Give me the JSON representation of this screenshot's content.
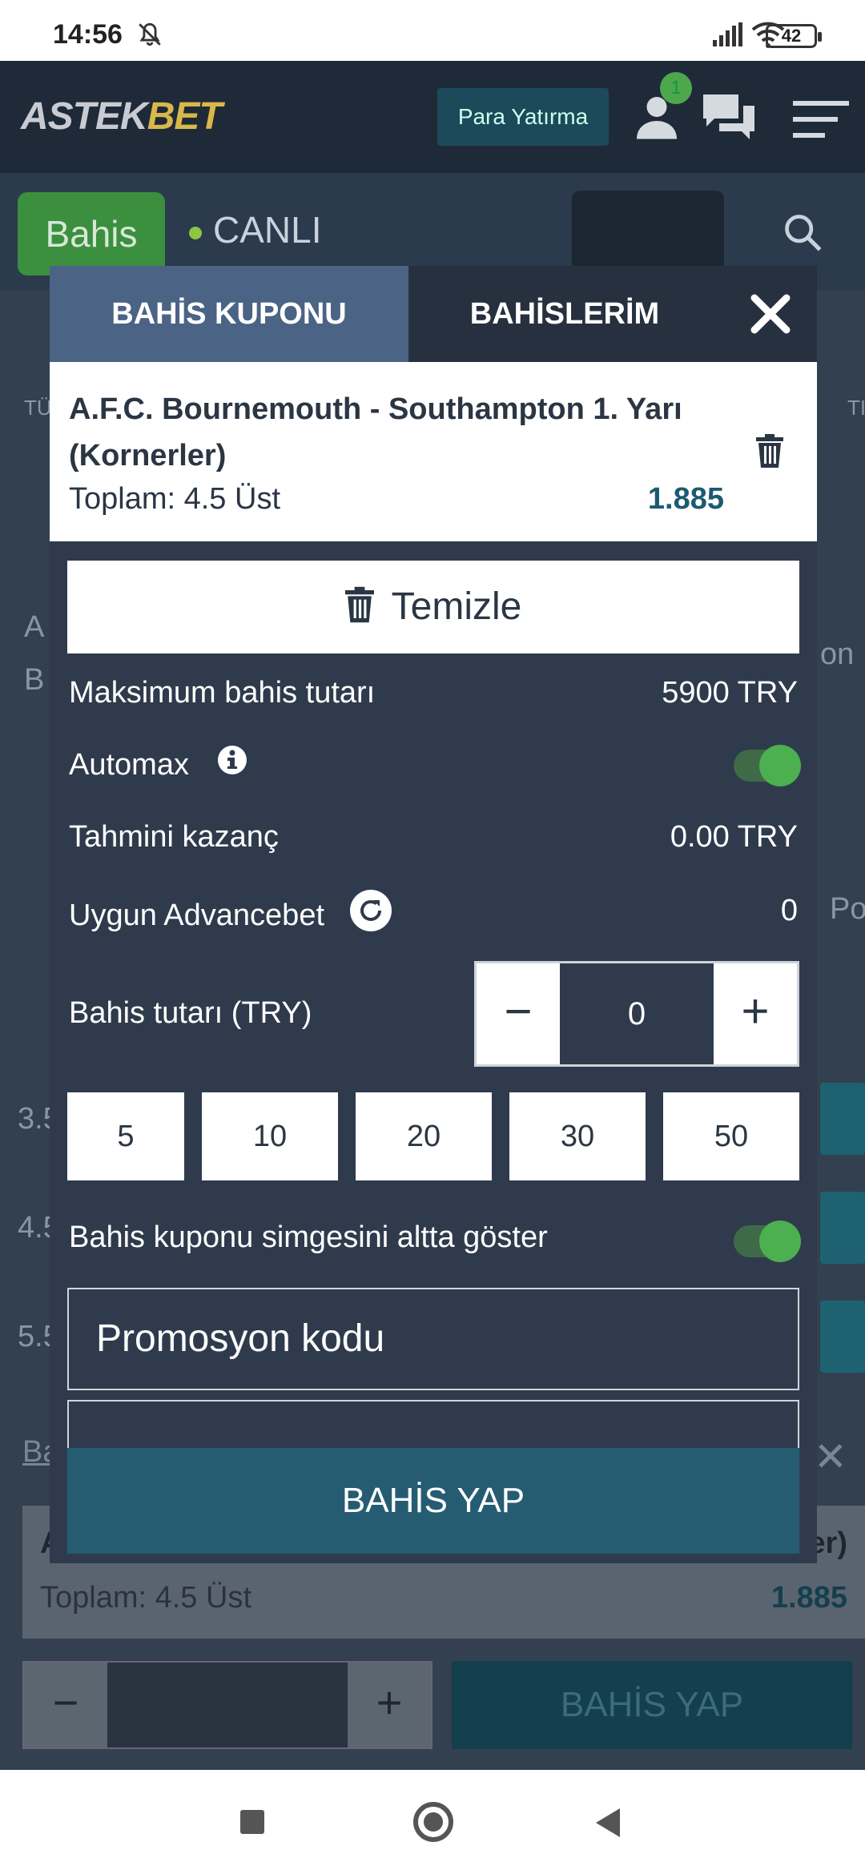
{
  "statusbar": {
    "time": "14:56",
    "battery": "42"
  },
  "header": {
    "logo_part1": "ASTEK",
    "logo_part2": "BET",
    "deposit_label": "Para Yatırma",
    "notif_count": "1"
  },
  "sportbar": {
    "bahis_label": "Bahis",
    "live_label": "CANLI"
  },
  "background": {
    "rows": [
      "TÜ",
      "A",
      "B",
      "3.5",
      "4.5",
      "5.5",
      "Po",
      "on",
      "TI"
    ],
    "slip_title": "Ba",
    "slip_match": "A",
    "slip_match_right": "er)",
    "slip_line": "Toplam: 4.5 Üst",
    "slip_odds": "1.885",
    "stepper_minus": "−",
    "stepper_plus": "+",
    "bet_label": "BAHİS YAP"
  },
  "modal": {
    "tab_coupon": "BAHİS KUPONU",
    "tab_mybets": "BAHİSLERİM",
    "selection": {
      "title": "A.F.C. Bournemouth - Southampton 1. Yarı (Kornerler)",
      "line": "Toplam: 4.5 Üst",
      "odds": "1.885"
    },
    "clear_label": "Temizle",
    "max_label": "Maksimum bahis tutarı",
    "max_value": "5900 TRY",
    "automax_label": "Automax",
    "estimated_label": "Tahmini kazanç",
    "estimated_value": "0.00 TRY",
    "advancebet_label": "Uygun Advancebet",
    "advancebet_value": "0",
    "stake_label": "Bahis tutarı (TRY)",
    "stake_minus": "−",
    "stake_value": "0",
    "stake_plus": "+",
    "quick_amounts": [
      "5",
      "10",
      "20",
      "30",
      "50"
    ],
    "show_icon_label": "Bahis kuponu simgesini altta göster",
    "promo_placeholder": "Promosyon kodu",
    "bet_label": "BAHİS YAP"
  },
  "nav": {}
}
